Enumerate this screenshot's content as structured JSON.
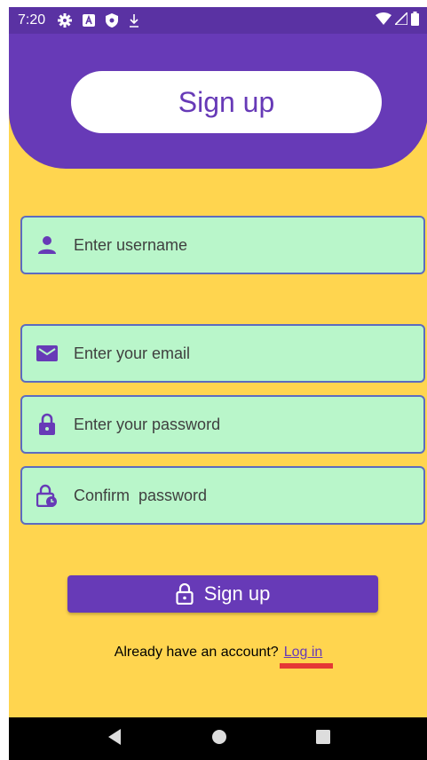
{
  "status_bar": {
    "time": "7:20",
    "left_icons": [
      "gear-icon",
      "a-badge-icon",
      "shield-icon",
      "download-icon"
    ],
    "right_icons": [
      "wifi-icon",
      "signal-icon",
      "battery-icon"
    ]
  },
  "header": {
    "title": "Sign up"
  },
  "form": {
    "username_placeholder": "Enter username",
    "email_placeholder": "Enter your email",
    "password_placeholder": "Enter your password",
    "confirm_placeholder": "Confirm  password"
  },
  "signup_button": {
    "label": "Sign up",
    "icon": "lock-open-icon"
  },
  "login_prompt": {
    "text": "Already have an account?",
    "link": "Log in"
  },
  "colors": {
    "primary": "#673ab7",
    "background": "#ffd54f",
    "field_fill": "#b9f6ca",
    "marker": "#e53935"
  }
}
